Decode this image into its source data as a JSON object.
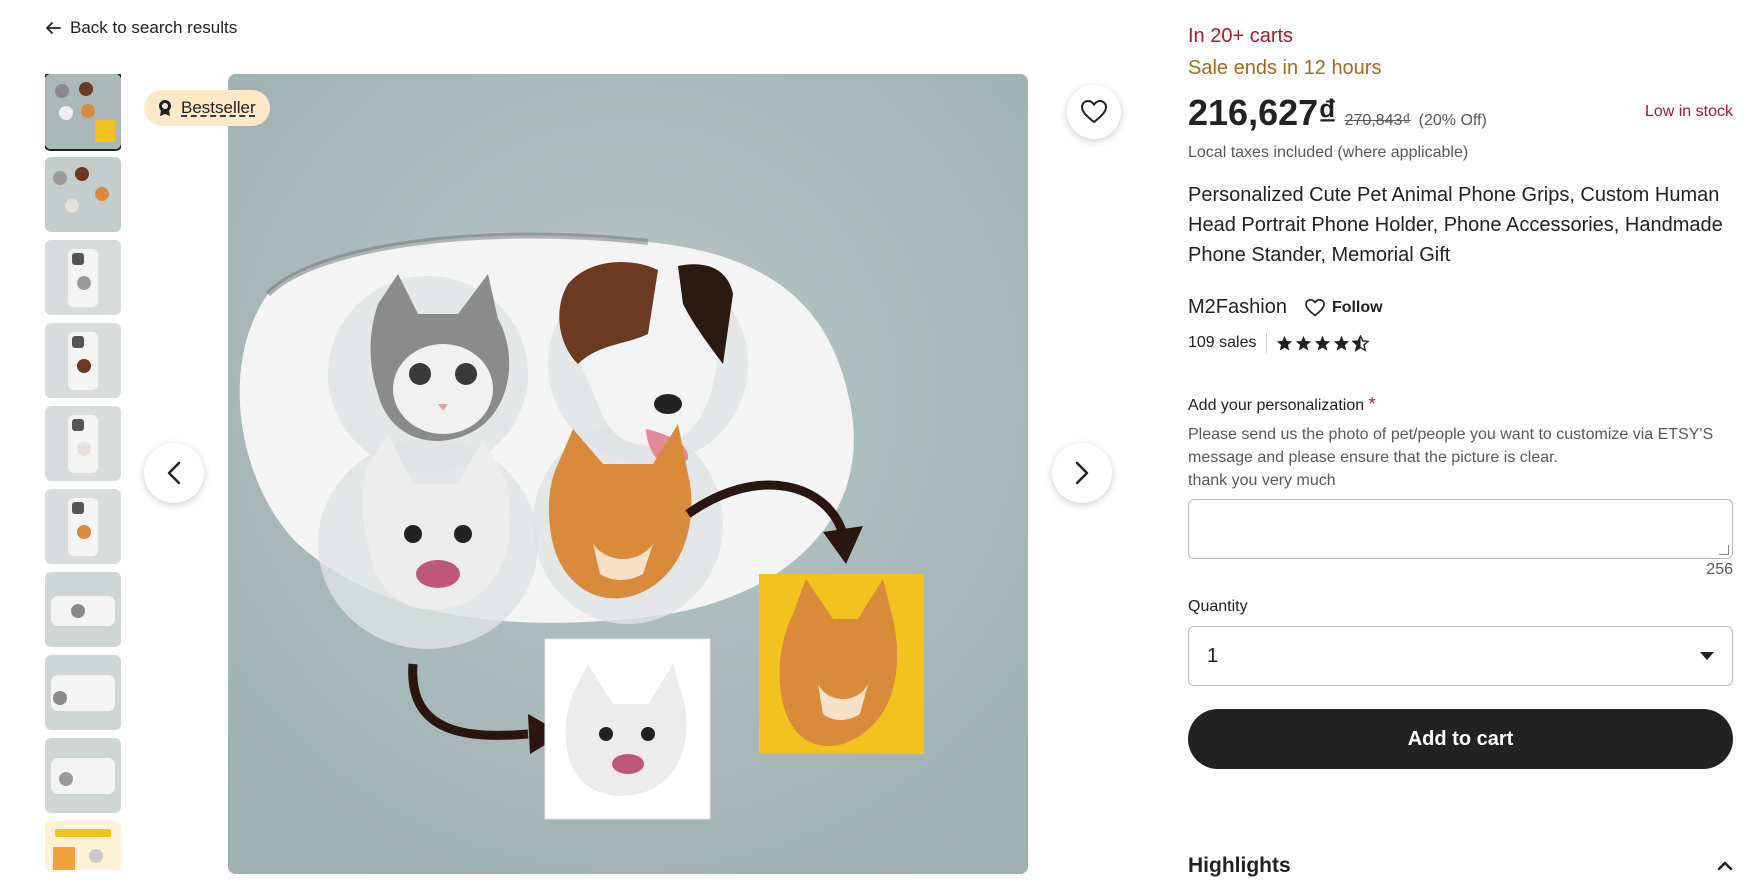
{
  "nav": {
    "back_label": "Back to search results"
  },
  "gallery": {
    "badge_label": "Bestseller",
    "thumbnail_count": 10
  },
  "listing": {
    "cart_status": "In 20+ carts",
    "sale_status": "Sale ends in 12 hours",
    "price": "216,627₫",
    "original_price": "270,843₫",
    "discount": "(20% Off)",
    "stock_status": "Low in stock",
    "taxes_note": "Local taxes included (where applicable)",
    "title": "Personalized Cute Pet Animal Phone Grips, Custom Human Head Portrait Phone Holder, Phone Accessories, Handmade Phone Stander, Memorial Gift"
  },
  "shop": {
    "name": "M2Fashion",
    "follow_label": "Follow",
    "sales": "109 sales",
    "rating": 4.5
  },
  "personalization": {
    "label": "Add your personalization",
    "required_mark": "*",
    "help_line1": "Please send us the photo of pet/people you want to customize via ETSY'S message and please ensure that the picture is clear.",
    "help_line2": "thank you very much",
    "value": "",
    "char_limit": "256"
  },
  "quantity": {
    "label": "Quantity",
    "selected": "1"
  },
  "actions": {
    "add_to_cart": "Add to cart"
  },
  "sections": {
    "highlights": "Highlights"
  },
  "colors": {
    "urgent": "#a61a2e",
    "sale": "#a66b18",
    "badge_bg": "#fde8c8",
    "button_dark": "#222222"
  }
}
